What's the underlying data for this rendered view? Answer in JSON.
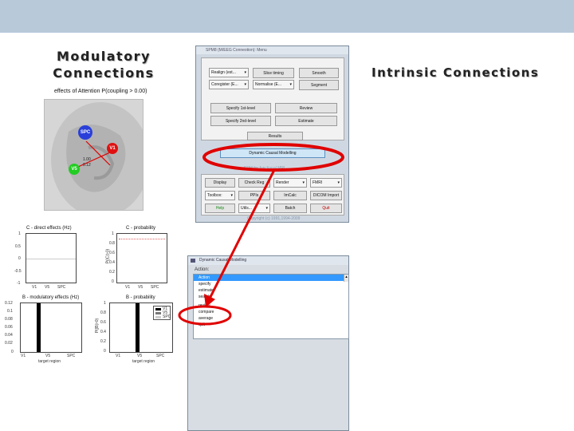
{
  "headings": {
    "modulatory": "Modulatory Connections",
    "intrinsic": "Intrinsic Connections"
  },
  "brain_panel": {
    "title": "effects of Attention P(coupling > 0.00)",
    "nodes": {
      "spc": "SPC",
      "v1": "V1",
      "v5": "V5"
    },
    "edge_label_1": "1.00",
    "edge_label_2": "0.12"
  },
  "plots": {
    "c_direct": {
      "title": "C - direct effects (Hz)",
      "yticks": [
        "1",
        "0.5",
        "0",
        "-0.5",
        "-1"
      ],
      "xticks": [
        "V1",
        "V5",
        "SPC"
      ]
    },
    "c_prob": {
      "title": "C - probability",
      "ylabel": "P(|C|>0)",
      "yticks": [
        "1",
        "0.8",
        "0.6",
        "0.4",
        "0.2",
        "0"
      ],
      "xticks": [
        "V1",
        "V5",
        "SPC"
      ]
    },
    "b_mod": {
      "title": "B - modulatory effects (Hz)",
      "yticks": [
        "0.12",
        "0.1",
        "0.08",
        "0.06",
        "0.04",
        "0.02",
        "0"
      ],
      "xticks": [
        "V1",
        "V5",
        "SPC"
      ],
      "xlabel": "target region",
      "value": 0.12
    },
    "b_prob": {
      "title": "B - probability",
      "ylabel": "P(|B|>0)",
      "yticks": [
        "1",
        "0.8",
        "0.6",
        "0.4",
        "0.2",
        "0"
      ],
      "xticks": [
        "V1",
        "V5",
        "SPC"
      ],
      "xlabel": "target region",
      "legend": [
        "V1",
        "V5",
        "SPC"
      ],
      "value": 1.0
    }
  },
  "spm": {
    "title": "SPM8 (M/EEG Conneotion): Menu",
    "row1": {
      "select1": "Realign (est...",
      "btn1": "Slice timing",
      "btn2": "Smooth"
    },
    "row2": {
      "select1": "Coregister (E...",
      "select2": "Normalise (E...",
      "btn1": "Segment"
    },
    "row3": {
      "btn1": "Specify 1st-level",
      "btn2": "Review"
    },
    "row4": {
      "btn1": "Specify 2nd-level",
      "btn2": "Estimate"
    },
    "row5": {
      "btn1": "Results"
    },
    "row6": {
      "btn1": "Dynamic Causal Modelling"
    },
    "footer_label": "SPM for functional MRI",
    "util1": {
      "btn1": "Display",
      "btn2": "Check Reg",
      "select1": "Render",
      "select2": "FMRI"
    },
    "util2": {
      "select1": "Toolbox:",
      "btn1": "PPIs",
      "btn2": "ImCalc",
      "btn3": "DICOM Import"
    },
    "util3": {
      "btn1": "Help",
      "select1": "Utils...",
      "btn2": "Batch",
      "btn3": "Quit"
    },
    "copyright": "Copyright (c) 1991,1994-2009"
  },
  "dcm": {
    "title": "Dynamic Causal Modelling",
    "action_label": "Action:",
    "actions": [
      "Action",
      "specify",
      "estimate",
      "search",
      "review",
      "compare",
      "average",
      "quit"
    ],
    "selected_index": 0
  },
  "colors": {
    "topbar": "#b8c9da",
    "node_spc": "#2a3fd9",
    "node_v1": "#e01010",
    "node_v5": "#22cc22",
    "annotation": "#e00000"
  }
}
